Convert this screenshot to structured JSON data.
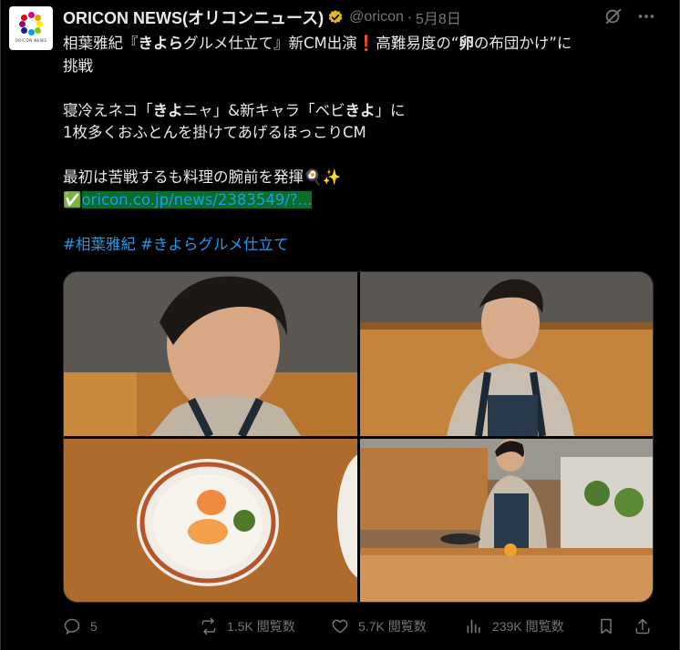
{
  "tweet": {
    "display_name": "ORICON NEWS(オリコンニュース)",
    "handle": "@oricon",
    "separator": "·",
    "date": "5月8日",
    "avatar_text": "ORICON NEWS",
    "lines": {
      "l1a": "相葉雅紀『",
      "l1b": "きよら",
      "l1c": "グルメ仕立て』新CM出演",
      "l1d": "❗",
      "l1e": "高難易度の“",
      "l1f": "卵",
      "l1g": "の布団かけ”に",
      "l2": "挑戦",
      "l3a": "寝冷えネコ「",
      "l3b": "きよ",
      "l3c": "ニャ」&新キャラ「ベビ",
      "l3d": "きよ",
      "l3e": "」に",
      "l4": "1枚多くおふとんを掛けてあげるほっこりCM",
      "l5": "最初は苦戦するも料理の腕前を発揮🍳✨",
      "l6_icon": "✅",
      "link": "oricon.co.jp/news/2383549/?...",
      "hashtag1": "#相葉雅紀",
      "hashtag2": "#きよらグルメ仕立て"
    }
  },
  "actions": {
    "replies": "5",
    "retweets": "1.5K 閲覧数",
    "likes": "5.7K 閲覧数",
    "views": "239K 閲覧数"
  },
  "colors": {
    "accent": "#1d9bf0",
    "muted": "#71767b",
    "verified": "#e2b719",
    "link_highlight": "#0a6d2a"
  },
  "icons": [
    "grok-icon",
    "more-icon",
    "verified-icon",
    "reply-icon",
    "retweet-icon",
    "like-icon",
    "views-icon",
    "bookmark-icon",
    "share-icon"
  ]
}
